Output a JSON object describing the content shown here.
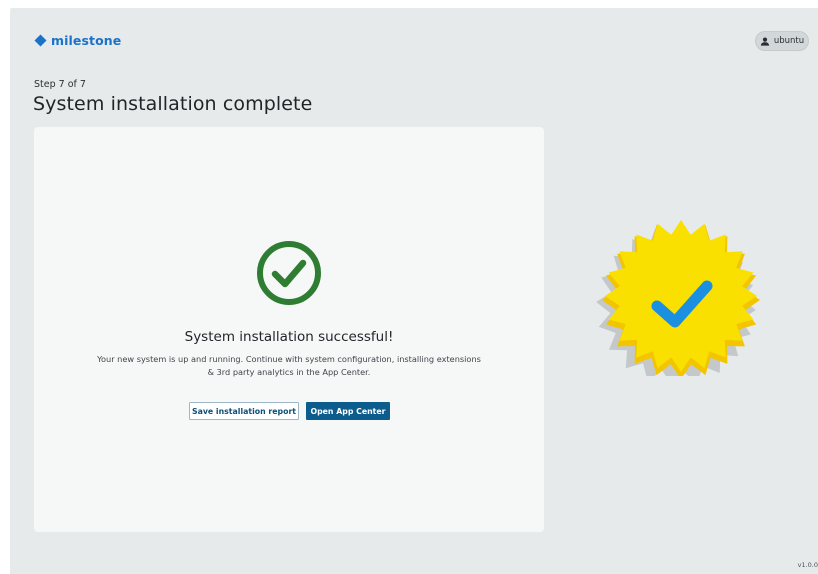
{
  "header": {
    "logo_text": "milestone",
    "user": "ubuntu"
  },
  "wizard": {
    "step": "Step 7 of 7",
    "title": "System installation complete"
  },
  "result": {
    "title": "System installation successful!",
    "line1": "Your new system is up and running. Continue with system configuration, installing extensions",
    "line2": "& 3rd party analytics in the App Center."
  },
  "actions": {
    "save_report": "Save installation report",
    "open_app_center": "Open App Center"
  },
  "footer": {
    "version": "v1.0.0"
  },
  "icons": {
    "logo": "diamond-logo-icon",
    "user": "user-icon",
    "success": "check-circle-icon",
    "badge": "verified-badge-icon"
  },
  "colors": {
    "brand": "#1a73c9",
    "success_green": "#2e7d32",
    "primary_button": "#0d5c8e",
    "badge_yellow": "#f9e000",
    "badge_check": "#1b8fe0"
  }
}
